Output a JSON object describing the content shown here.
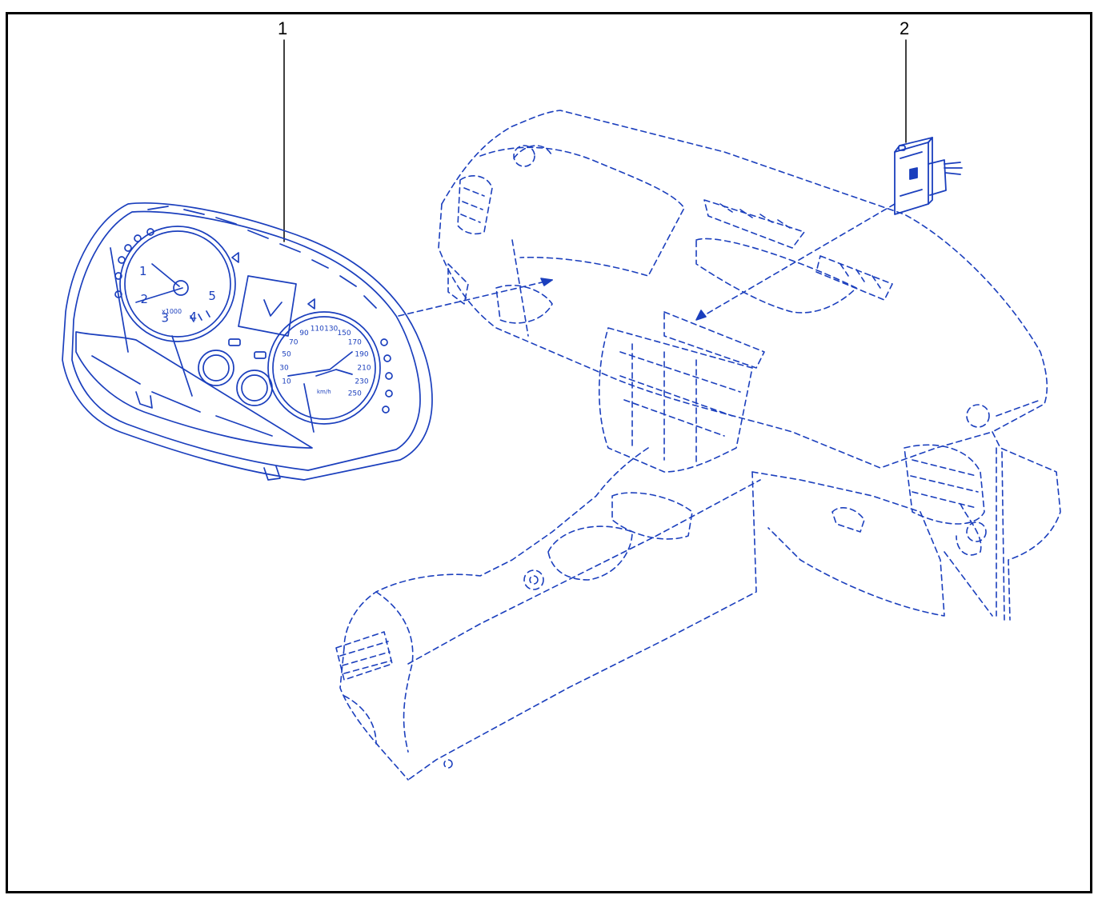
{
  "colors": {
    "line": "#1b3fbd",
    "frame": "#000000",
    "background": "#ffffff"
  },
  "callouts": [
    {
      "number": "1",
      "part": "instrument-cluster"
    },
    {
      "number": "2",
      "part": "module-with-connector"
    }
  ],
  "cluster": {
    "tach_numbers": [
      "1",
      "2",
      "3",
      "4",
      "5"
    ],
    "tach_unit": "x1000",
    "speedo_numbers": [
      "10",
      "30",
      "50",
      "70",
      "90",
      "110",
      "130",
      "150",
      "170",
      "190",
      "210",
      "230",
      "250"
    ],
    "speedo_unit": "km/h"
  }
}
